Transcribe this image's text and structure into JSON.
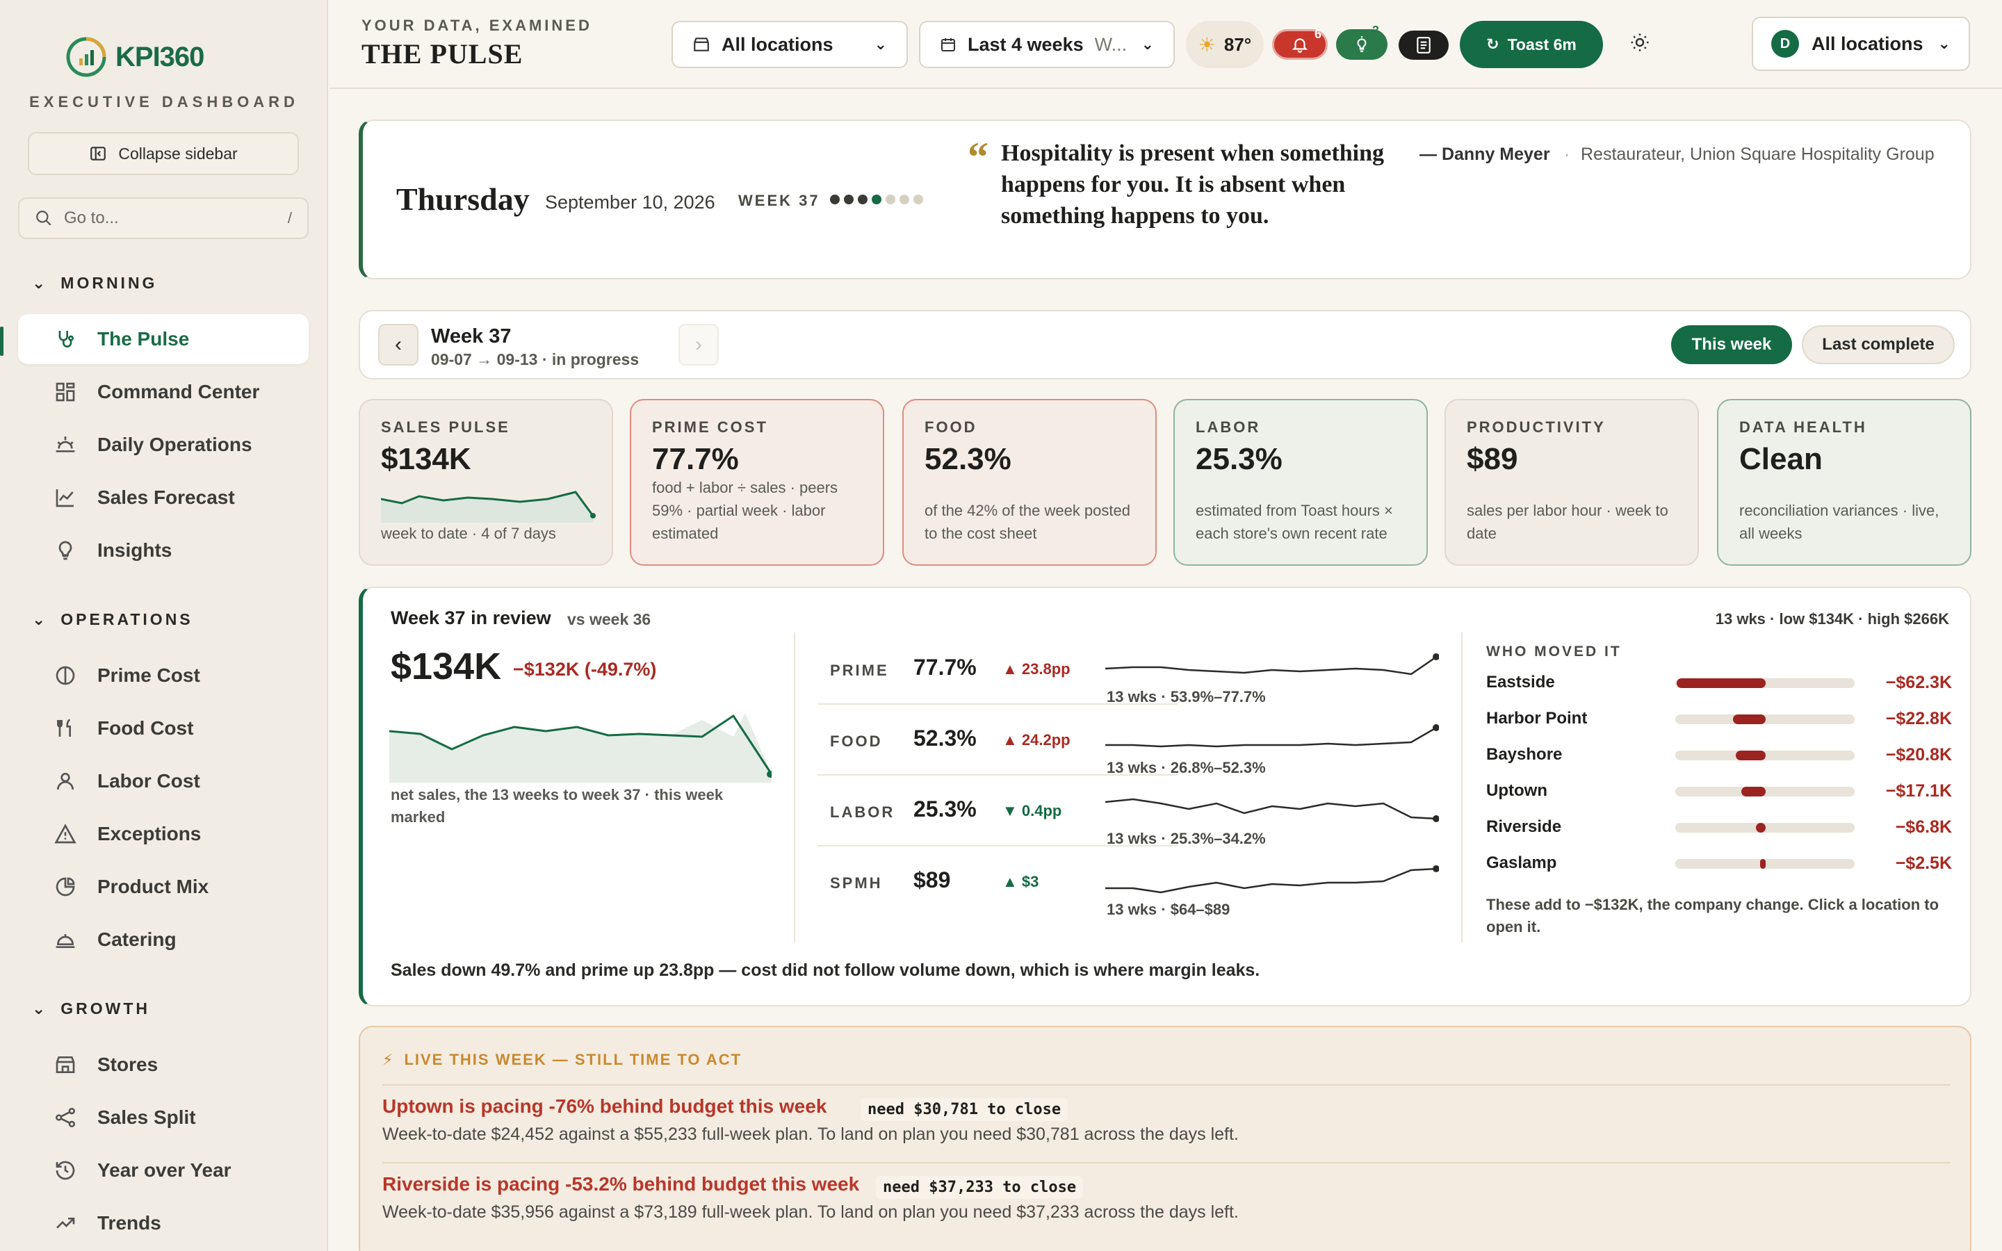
{
  "brand": {
    "name": "KPI360",
    "subtitle": "EXECUTIVE DASHBOARD"
  },
  "sidebar": {
    "collapse_label": "Collapse sidebar",
    "goto_placeholder": "Go to...",
    "goto_shortcut": "/",
    "sections": [
      {
        "label": "MORNING",
        "items": [
          "The Pulse",
          "Command Center",
          "Daily Operations",
          "Sales Forecast",
          "Insights"
        ]
      },
      {
        "label": "OPERATIONS",
        "items": [
          "Prime Cost",
          "Food Cost",
          "Labor Cost",
          "Exceptions",
          "Product Mix",
          "Catering"
        ]
      },
      {
        "label": "GROWTH",
        "items": [
          "Stores",
          "Sales Split",
          "Year over Year",
          "Trends"
        ]
      }
    ],
    "active_item": "The Pulse"
  },
  "header": {
    "eyebrow": "YOUR DATA, EXAMINED",
    "title": "THE PULSE",
    "location_filter": "All locations",
    "period_filter": "Last 4 weeks",
    "period_filter_suffix": "W...",
    "weather_temp": "87°",
    "alerts_count": "6",
    "insights_count": "3",
    "toast_label": "Toast 6m",
    "account_initial": "D",
    "account_location": "All locations"
  },
  "today": {
    "day": "Thursday",
    "date": "September 10, 2026",
    "week_label": "WEEK 37",
    "progress_days_elapsed": 4,
    "progress_days_total": 7,
    "quote": "Hospitality is present when something happens for you. It is absent when something happens to you.",
    "author": "— Danny Meyer",
    "author_role": "Restaurateur, Union Square Hospitality Group"
  },
  "week_nav": {
    "title": "Week 37",
    "subtitle": "09-07 → 09-13 · in progress",
    "this_week": "This week",
    "last_complete": "Last complete"
  },
  "kpis": [
    {
      "label": "SALES PULSE",
      "value": "$134K",
      "desc": "week to date · 4 of 7 days",
      "tone": "neutral"
    },
    {
      "label": "PRIME COST",
      "value": "77.7%",
      "desc": "food + labor ÷ sales · peers 59% · partial week · labor estimated",
      "tone": "red"
    },
    {
      "label": "FOOD",
      "value": "52.3%",
      "desc": "of the 42% of the week posted to the cost sheet",
      "tone": "red"
    },
    {
      "label": "LABOR",
      "value": "25.3%",
      "desc": "estimated from Toast hours × each store's own recent rate",
      "tone": "green"
    },
    {
      "label": "PRODUCTIVITY",
      "value": "$89",
      "desc": "sales per labor hour · week to date",
      "tone": "neutral"
    },
    {
      "label": "DATA HEALTH",
      "value": "Clean",
      "desc": "reconciliation variances · live, all weeks",
      "tone": "green"
    }
  ],
  "review": {
    "title": "Week 37 in review",
    "vs": "vs week 36",
    "range": "13 wks · low $134K · high $266K",
    "net_sales": "$134K",
    "delta": "−$132K (-49.7%)",
    "caption": "net sales, the 13 weeks to week 37 · this week marked",
    "metrics": [
      {
        "label": "PRIME",
        "value": "77.7%",
        "delta": "▲ 23.8pp",
        "dir": "up",
        "range": "13 wks · 53.9%–77.7%"
      },
      {
        "label": "FOOD",
        "value": "52.3%",
        "delta": "▲ 24.2pp",
        "dir": "up",
        "range": "13 wks · 26.8%–52.3%"
      },
      {
        "label": "LABOR",
        "value": "25.3%",
        "delta": "▼ 0.4pp",
        "dir": "down",
        "range": "13 wks · 25.3%–34.2%"
      },
      {
        "label": "SPMH",
        "value": "$89",
        "delta": "▲ $3",
        "dir": "down",
        "range": "13 wks · $64–$89"
      }
    ],
    "who_title": "WHO MOVED IT",
    "movers": [
      {
        "name": "Eastside",
        "value": "−$62.3K",
        "amount": 62.3
      },
      {
        "name": "Harbor Point",
        "value": "−$22.8K",
        "amount": 22.8
      },
      {
        "name": "Bayshore",
        "value": "−$20.8K",
        "amount": 20.8
      },
      {
        "name": "Uptown",
        "value": "−$17.1K",
        "amount": 17.1
      },
      {
        "name": "Riverside",
        "value": "−$6.8K",
        "amount": 6.8
      },
      {
        "name": "Gaslamp",
        "value": "−$2.5K",
        "amount": 2.5
      }
    ],
    "who_note": "These add to −$132K, the company change. Click a location to open it.",
    "summary": "Sales down 49.7% and prime up 23.8pp — cost did not follow volume down, which is where margin leaks."
  },
  "live": {
    "title": "LIVE THIS WEEK — STILL TIME TO ACT",
    "alerts": [
      {
        "title": "Uptown is pacing -76% behind budget this week",
        "need": "need $30,781 to close",
        "desc": "Week-to-date $24,452 against a $55,233 full-week plan. To land on plan you need $30,781 across the days left."
      },
      {
        "title": "Riverside is pacing -53.2% behind budget this week",
        "need": "need $37,233 to close",
        "desc": "Week-to-date $35,956 against a $73,189 full-week plan. To land on plan you need $37,233 across the days left."
      }
    ]
  },
  "colors": {
    "brand": "#146b44",
    "negative": "#a82a22",
    "accent": "#c9892e"
  }
}
